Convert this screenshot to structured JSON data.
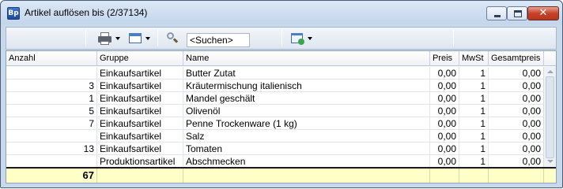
{
  "window": {
    "app_icon_text": "Bp",
    "title": "Artikel auflösen bis (2/37134)",
    "close_glyph": "✕"
  },
  "toolbar": {
    "search_placeholder": "<Suchen>",
    "search_value": "<Suchen>"
  },
  "columns": [
    "Anzahl",
    "Gruppe",
    "Name",
    "Preis",
    "MwSt",
    "Gesamtpreis"
  ],
  "rows": [
    {
      "anzahl": "",
      "gruppe": "Einkaufsartikel",
      "name": "Butter Zutat",
      "preis": "0,00",
      "mwst": "1",
      "gesamtpreis": "0,00"
    },
    {
      "anzahl": "3",
      "gruppe": "Einkaufsartikel",
      "name": "Kräutermischung italienisch",
      "preis": "0,00",
      "mwst": "1",
      "gesamtpreis": "0,00"
    },
    {
      "anzahl": "1",
      "gruppe": "Einkaufsartikel",
      "name": "Mandel geschält",
      "preis": "0,00",
      "mwst": "1",
      "gesamtpreis": "0,00"
    },
    {
      "anzahl": "5",
      "gruppe": "Einkaufsartikel",
      "name": "Olivenöl",
      "preis": "0,00",
      "mwst": "1",
      "gesamtpreis": "0,00"
    },
    {
      "anzahl": "7",
      "gruppe": "Einkaufsartikel",
      "name": "Penne Trockenware (1 kg)",
      "preis": "0,00",
      "mwst": "1",
      "gesamtpreis": "0,00"
    },
    {
      "anzahl": "",
      "gruppe": "Einkaufsartikel",
      "name": "Salz",
      "preis": "0,00",
      "mwst": "1",
      "gesamtpreis": "0,00"
    },
    {
      "anzahl": "13",
      "gruppe": "Einkaufsartikel",
      "name": "Tomaten",
      "preis": "0,00",
      "mwst": "1",
      "gesamtpreis": "0,00"
    },
    {
      "anzahl": "",
      "gruppe": "Produktionsartikel",
      "name": "Abschmecken",
      "preis": "0,00",
      "mwst": "1",
      "gesamtpreis": "0,00"
    }
  ],
  "summary": {
    "anzahl_total": "67"
  },
  "colors": {
    "summary_background": "#ffffc8",
    "titlebar": "#c4d6ec",
    "close_button": "#c6432a"
  },
  "icons": [
    "printer-icon",
    "table-view-icon",
    "magnifier-icon",
    "export-icon"
  ]
}
